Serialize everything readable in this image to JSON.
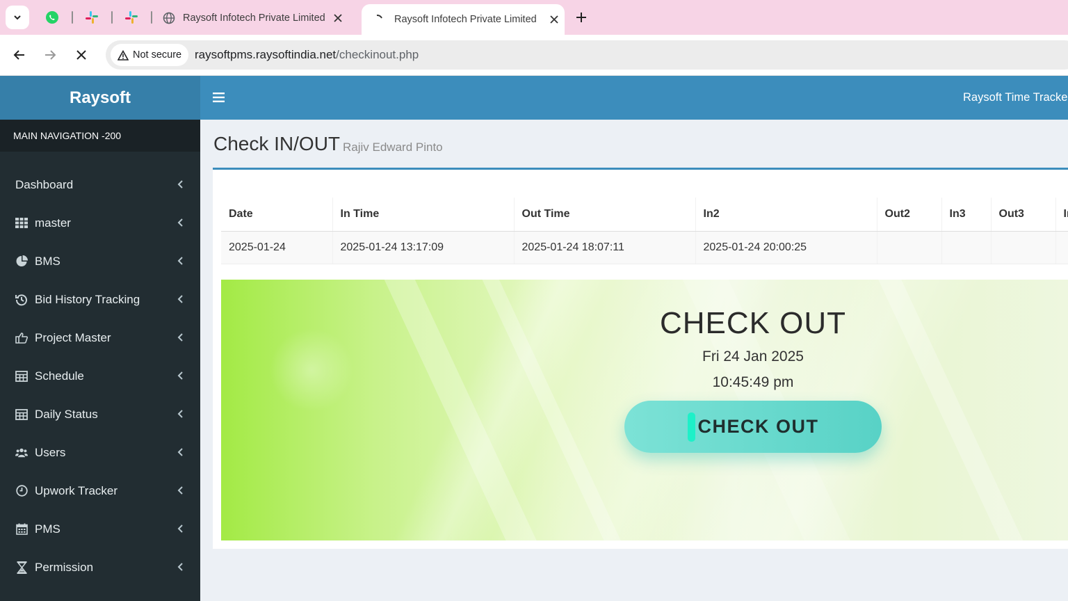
{
  "browser": {
    "tabs": [
      {
        "title": "Raysoft Infotech Private Limited",
        "active": false
      },
      {
        "title": "Raysoft Infotech Private Limited",
        "active": true
      }
    ],
    "security_label": "Not secure",
    "url_host": "raysoftpms.raysoftindia.net",
    "url_path": "/checkinout.php",
    "pinned_icons": [
      "whatsapp-icon",
      "slack-icon",
      "slack-icon"
    ]
  },
  "app": {
    "logo": "Raysoft",
    "topbar_title": "Raysoft Time Tracker",
    "nav_header": "MAIN NAVIGATION -200",
    "nav_items": [
      {
        "label": "Dashboard",
        "icon": "none"
      },
      {
        "label": "master",
        "icon": "grid-icon"
      },
      {
        "label": "BMS",
        "icon": "pie-chart-icon"
      },
      {
        "label": "Bid History Tracking",
        "icon": "history-icon"
      },
      {
        "label": "Project Master",
        "icon": "hand-pointer-icon"
      },
      {
        "label": "Schedule",
        "icon": "table-icon"
      },
      {
        "label": "Daily Status",
        "icon": "table-icon"
      },
      {
        "label": "Users",
        "icon": "users-icon"
      },
      {
        "label": "Upwork Tracker",
        "icon": "clock-icon"
      },
      {
        "label": "PMS",
        "icon": "calendar-icon"
      },
      {
        "label": "Permission",
        "icon": "hourglass-icon"
      }
    ]
  },
  "page": {
    "title": "Check IN/OUT",
    "subtitle": "Rajiv Edward Pinto",
    "table": {
      "headers": [
        "Date",
        "In Time",
        "Out Time",
        "In2",
        "Out2",
        "In3",
        "Out3",
        "In"
      ],
      "rows": [
        [
          "2025-01-24",
          "2025-01-24 13:17:09",
          "2025-01-24 18:07:11",
          "2025-01-24 20:00:25",
          "",
          "",
          "",
          ""
        ]
      ]
    },
    "checkout": {
      "heading": "CHECK OUT",
      "date": "Fri 24 Jan 2025",
      "time": "10:45:49 pm",
      "button_label": "CHECK OUT"
    }
  },
  "colors": {
    "sidebar_bg": "#222d32",
    "header_blue": "#3c8dbc",
    "logo_blue": "#367fa9",
    "tab_strip": "#f7d4e6",
    "button_teal": "#58d2c6"
  }
}
